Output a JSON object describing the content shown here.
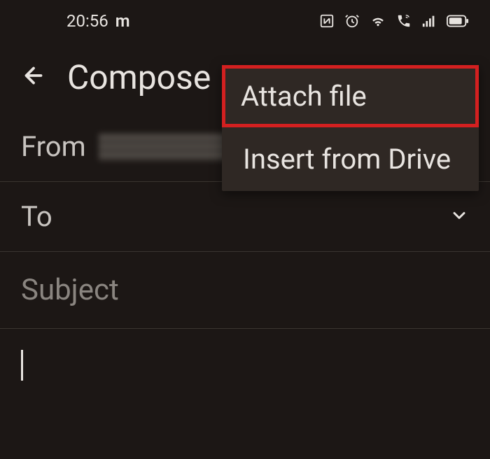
{
  "status_bar": {
    "time": "20:56",
    "app_indicator": "m"
  },
  "header": {
    "title": "Compose"
  },
  "dropdown": {
    "items": [
      {
        "label": "Attach file",
        "highlighted": true
      },
      {
        "label": "Insert from Drive",
        "highlighted": false
      }
    ]
  },
  "form": {
    "from_label": "From",
    "to_label": "To",
    "subject_placeholder": "Subject"
  }
}
